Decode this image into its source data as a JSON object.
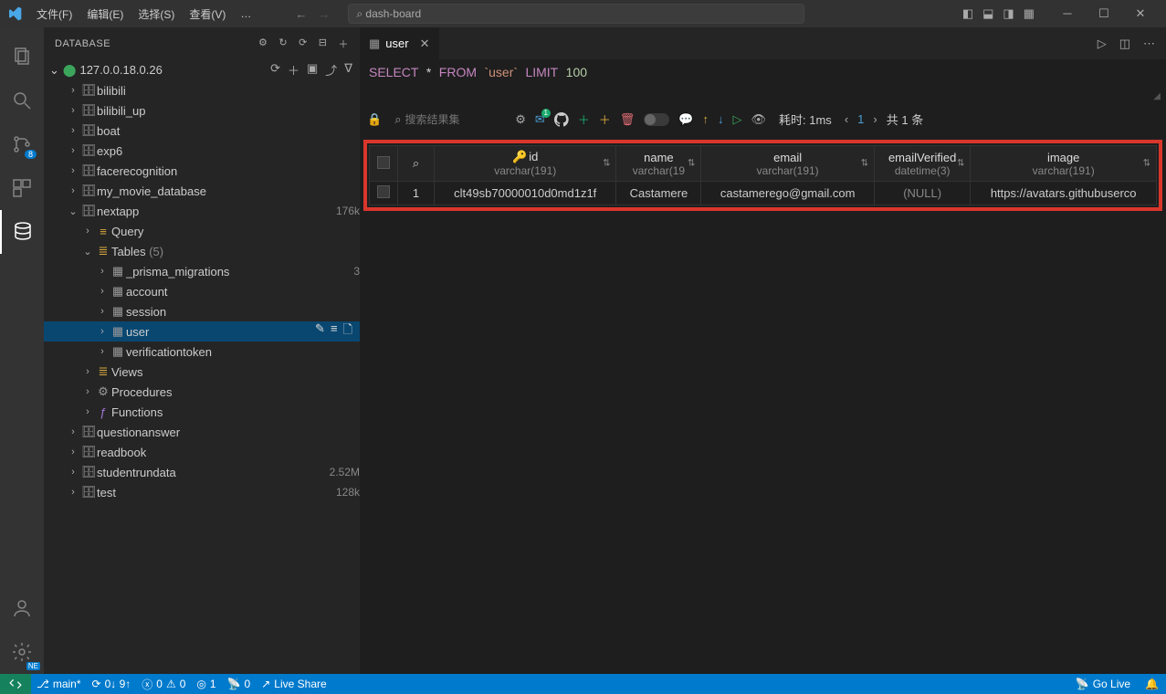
{
  "titlebar": {
    "menu": [
      "文件(F)",
      "编辑(E)",
      "选择(S)",
      "查看(V)",
      "…"
    ],
    "search_text": "dash-board"
  },
  "sidebar": {
    "title": "DATABASE",
    "connection": {
      "host": "127.0.0.1",
      "version": "8.0.26"
    },
    "databases": [
      {
        "name": "bilibili"
      },
      {
        "name": "bilibili_up"
      },
      {
        "name": "boat"
      },
      {
        "name": "exp6"
      },
      {
        "name": "facerecognition"
      },
      {
        "name": "my_movie_database"
      },
      {
        "name": "nextapp",
        "meta": "176k",
        "expanded": true,
        "children": {
          "query": "Query",
          "tables": {
            "label": "Tables",
            "count": "(5)",
            "items": [
              {
                "name": "_prisma_migrations",
                "meta": "3"
              },
              {
                "name": "account"
              },
              {
                "name": "session"
              },
              {
                "name": "user",
                "selected": true
              },
              {
                "name": "verificationtoken"
              }
            ]
          },
          "views": "Views",
          "procedures": "Procedures",
          "functions": "Functions"
        }
      },
      {
        "name": "questionanswer"
      },
      {
        "name": "readbook"
      },
      {
        "name": "studentrundata",
        "meta": "2.52M"
      },
      {
        "name": "test",
        "meta": "128k"
      }
    ]
  },
  "editor": {
    "tab": {
      "label": "user"
    },
    "sql": {
      "select": "SELECT",
      "star": "*",
      "from": "FROM",
      "table": "`user`",
      "limit": "LIMIT",
      "num": "100"
    },
    "toolbar": {
      "filter_placeholder": "搜索结果集",
      "mail_badge": "1",
      "timing_label": "耗时:",
      "timing_value": "1ms",
      "page_current": "1",
      "page_total_prefix": "共",
      "page_total_count": "1",
      "page_total_suffix": "条"
    },
    "columns": [
      {
        "name": "id",
        "type": "varchar(191)",
        "key": true
      },
      {
        "name": "name",
        "type": "varchar(19"
      },
      {
        "name": "email",
        "type": "varchar(191)"
      },
      {
        "name": "emailVerified",
        "type": "datetime(3)"
      },
      {
        "name": "image",
        "type": "varchar(191)"
      }
    ],
    "rows": [
      {
        "num": "1",
        "id": "clt49sb70000010d0md1z1f",
        "name": "Castamere",
        "email": "castamerego@gmail.com",
        "emailVerified": "(NULL)",
        "image": "https://avatars.githubuserco"
      }
    ]
  },
  "statusbar": {
    "branch": "main*",
    "sync": "0↓ 9↑",
    "errors": "0",
    "warnings": "0",
    "ports": "1",
    "forward": "0",
    "liveshare": "Live Share",
    "golive": "Go Live"
  }
}
